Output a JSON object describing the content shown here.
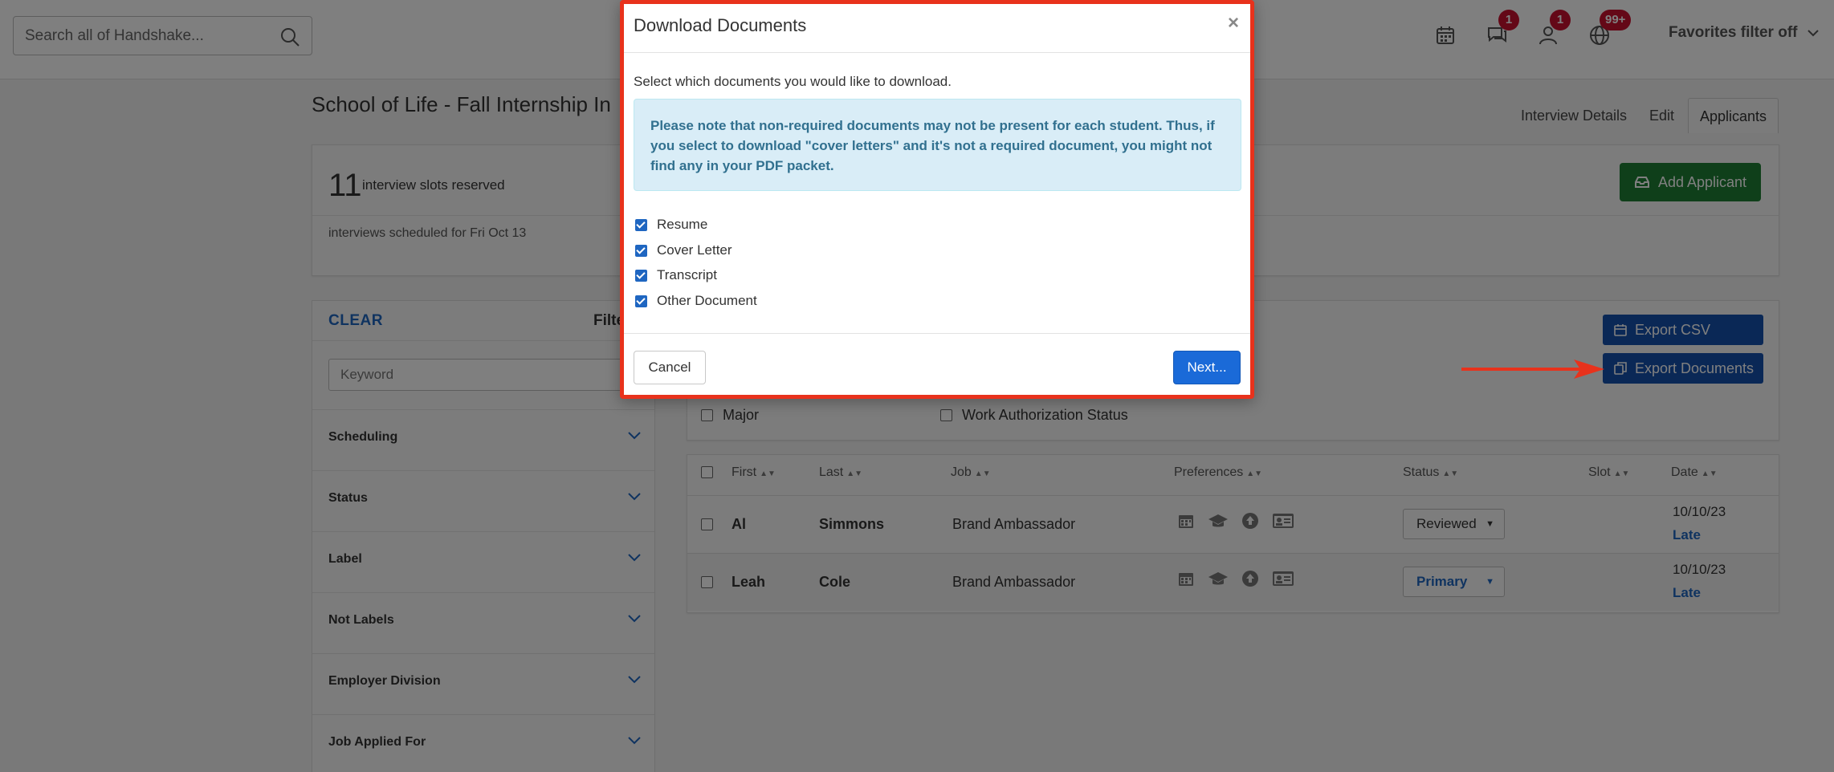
{
  "search": {
    "placeholder": "Search all of Handshake..."
  },
  "topbar": {
    "badges": {
      "messages": "1",
      "connections": "1",
      "notifications": "99+"
    },
    "favorites_filter": "Favorites filter off"
  },
  "page": {
    "title": "School of Life - Fall Internship In",
    "tabs": [
      {
        "label": "Interview Details"
      },
      {
        "label": "Edit"
      },
      {
        "label": "Applicants"
      }
    ]
  },
  "summary": {
    "slots_count": "11",
    "slots_label": "interview slots reserved",
    "scheduled_text": "interviews scheduled for Fri Oct 13",
    "add_applicant": "Add Applicant"
  },
  "sidebar": {
    "clear": "CLEAR",
    "filters_label": "Filte",
    "keyword_placeholder": "Keyword",
    "sections": [
      {
        "label": "Scheduling"
      },
      {
        "label": "Status"
      },
      {
        "label": "Label"
      },
      {
        "label": "Not Labels"
      },
      {
        "label": "Employer Division"
      },
      {
        "label": "Job Applied For"
      }
    ]
  },
  "applicants_panel": {
    "export_csv": "Export CSV",
    "export_documents": "Export Documents",
    "column_options": [
      {
        "label": "Major"
      },
      {
        "label": "Work Authorization Status"
      }
    ]
  },
  "table": {
    "headers": [
      "First",
      "Last",
      "Job",
      "Preferences",
      "Status",
      "Slot",
      "Date"
    ],
    "rows": [
      {
        "first": "Al",
        "last": "Simmons",
        "job": "Brand Ambassador",
        "status": "Reviewed",
        "date": "10/10/23",
        "late": "Late"
      },
      {
        "first": "Leah",
        "last": "Cole",
        "job": "Brand Ambassador",
        "status": "Primary",
        "date": "10/10/23",
        "late": "Late"
      }
    ]
  },
  "modal": {
    "title": "Download Documents",
    "close": "×",
    "intro": "Select which documents you would like to download.",
    "notice": "Please note that non-required documents may not be present for each student. Thus, if you select to download \"cover letters\" and it's not a required document, you might not find any in your PDF packet.",
    "options": [
      {
        "label": "Resume",
        "checked": true
      },
      {
        "label": "Cover Letter",
        "checked": true
      },
      {
        "label": "Transcript",
        "checked": true
      },
      {
        "label": "Other Document",
        "checked": true
      }
    ],
    "cancel": "Cancel",
    "next": "Next..."
  },
  "colors": {
    "primary_blue": "#1451ad",
    "add_green": "#1e7e34",
    "badge_red": "#c8102e",
    "highlight_red": "#e8321c",
    "notice_bg": "#d9edf7"
  }
}
